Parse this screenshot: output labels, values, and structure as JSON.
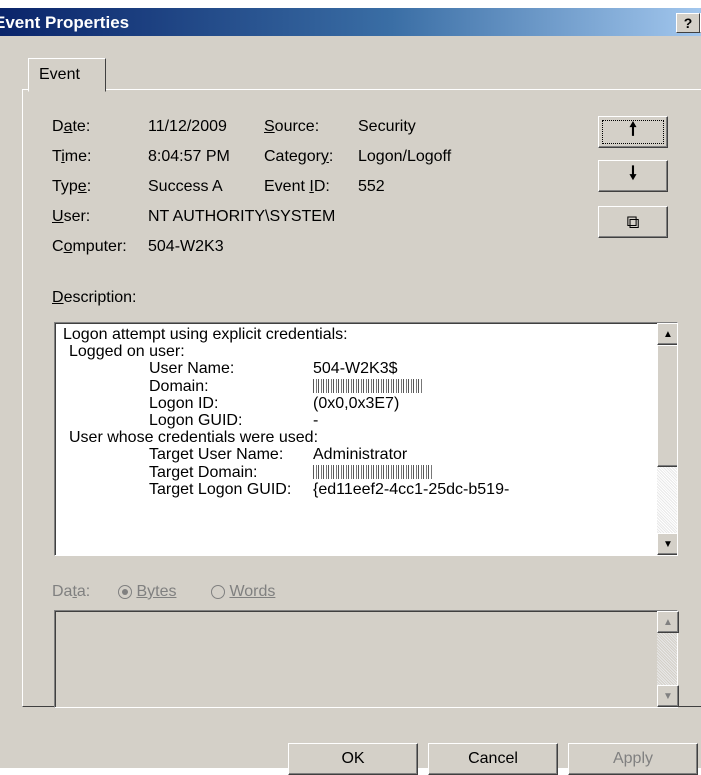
{
  "window": {
    "title": "Event Properties",
    "help_label": "?",
    "close_label": "×"
  },
  "tabs": [
    "Event"
  ],
  "fields": {
    "date": {
      "label": "Date:",
      "value": "11/12/2009"
    },
    "time": {
      "label": "Time:",
      "value": "8:04:57 PM"
    },
    "type": {
      "label": "Type:",
      "value": "Success A"
    },
    "user": {
      "label": "User:",
      "value": "NT AUTHORITY\\SYSTEM"
    },
    "computer": {
      "label": "Computer:",
      "value": "504-W2K3"
    },
    "source": {
      "label": "Source:",
      "value": "Security"
    },
    "category": {
      "label": "Category:",
      "value": "Logon/Logoff"
    },
    "event_id": {
      "label": "Event ID:",
      "value": "552"
    }
  },
  "nav_buttons": {
    "up": "🠕",
    "down": "🠗",
    "copy": "⧉"
  },
  "description": {
    "label": "Description:",
    "lines": [
      {
        "indent": 0,
        "key": "Logon attempt using explicit credentials:",
        "value": ""
      },
      {
        "indent": 1,
        "key": "Logged on user:",
        "value": ""
      },
      {
        "indent": 2,
        "key": "User Name:",
        "value": "504-W2K3$"
      },
      {
        "indent": 2,
        "key": "Domain:",
        "value": "",
        "redacted": true
      },
      {
        "indent": 2,
        "key": "Logon ID:",
        "value": "(0x0,0x3E7)"
      },
      {
        "indent": 2,
        "key": "Logon GUID:",
        "value": "-"
      },
      {
        "indent": 1,
        "key": "User whose credentials were used:",
        "value": ""
      },
      {
        "indent": 2,
        "key": "Target User Name:",
        "value": "Administrator"
      },
      {
        "indent": 2,
        "key": "Target Domain:",
        "value": "",
        "redacted": true
      },
      {
        "indent": 2,
        "key": "Target Logon GUID:",
        "value": "{ed11eef2-4cc1-25dc-b519-"
      }
    ]
  },
  "data_section": {
    "label": "Data:",
    "radio_bytes": "Bytes",
    "radio_words": "Words",
    "selected": "Bytes"
  },
  "buttons": {
    "ok": "OK",
    "cancel": "Cancel",
    "apply": "Apply"
  },
  "colors": {
    "dialog_face": "#d4d0c8",
    "title_start": "#0a246a",
    "title_end": "#a6caf0"
  }
}
